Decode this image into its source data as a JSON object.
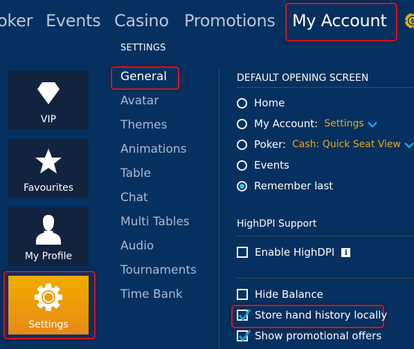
{
  "topnav": {
    "items": [
      {
        "label": "oker",
        "active": false
      },
      {
        "label": "Events",
        "active": false
      },
      {
        "label": "Casino",
        "active": false
      },
      {
        "label": "Promotions",
        "active": false
      },
      {
        "label": "My Account",
        "active": true
      }
    ],
    "coin_icon": "casino-chip-icon"
  },
  "sidebar": {
    "tiles": [
      {
        "label": "VIP",
        "icon": "diamond-icon",
        "active": false
      },
      {
        "label": "Favourites",
        "icon": "star-icon",
        "active": false
      },
      {
        "label": "My Profile",
        "icon": "user-icon",
        "active": false
      },
      {
        "label": "Settings",
        "icon": "gear-icon",
        "active": true
      }
    ]
  },
  "settings_menu": {
    "section_label": "SETTINGS",
    "items": [
      {
        "label": "General",
        "active": true
      },
      {
        "label": "Avatar"
      },
      {
        "label": "Themes"
      },
      {
        "label": "Animations"
      },
      {
        "label": "Table"
      },
      {
        "label": "Chat"
      },
      {
        "label": "Multi Tables"
      },
      {
        "label": "Audio"
      },
      {
        "label": "Tournaments"
      },
      {
        "label": "Time Bank"
      }
    ]
  },
  "general": {
    "default_opening_screen": {
      "heading": "DEFAULT OPENING SCREEN",
      "options": [
        {
          "label": "Home",
          "checked": false
        },
        {
          "label": "My Account:",
          "value": "Settings",
          "checked": false
        },
        {
          "label": "Poker:",
          "value": "Cash: Quick Seat View",
          "checked": false
        },
        {
          "label": "Events",
          "checked": false
        },
        {
          "label": "Remember last",
          "checked": true
        }
      ]
    },
    "highdpi": {
      "heading": "HighDPI Support",
      "enable_label": "Enable HighDPI",
      "enable_checked": false,
      "info_glyph": "i"
    },
    "misc": [
      {
        "label": "Hide Balance",
        "checked": false
      },
      {
        "label": "Store hand history locally",
        "checked": true
      },
      {
        "label": "Show promotional offers",
        "checked": true
      }
    ]
  },
  "colors": {
    "background": "#06305f",
    "tile": "#12233f",
    "accent_orange": "#f0ac00",
    "value_gold": "#e8a81c",
    "radio_blue": "#3cc0f2",
    "check_blue": "#1a9ad6",
    "highlight_red": "#e0101c"
  }
}
